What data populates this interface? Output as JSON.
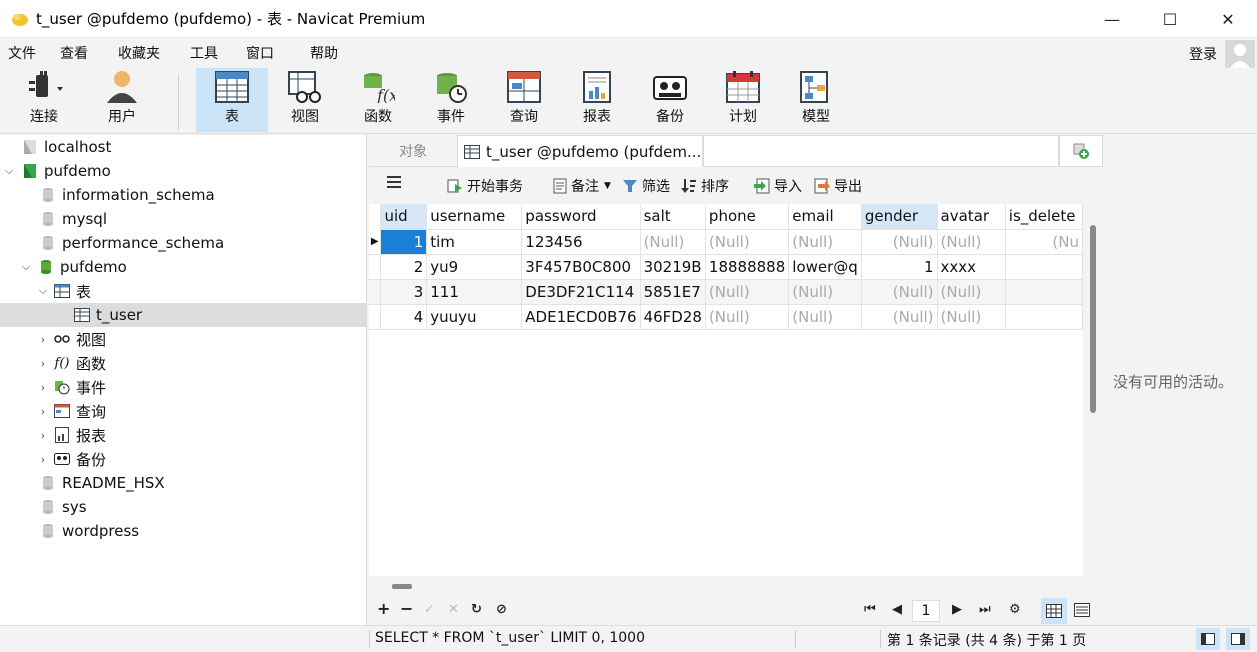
{
  "window": {
    "title": "t_user @pufdemo (pufdemo) - 表 - Navicat Premium",
    "minimize": "—",
    "maximize": "☐",
    "close": "✕"
  },
  "menu": {
    "items": [
      "文件",
      "查看",
      "收藏夹",
      "工具",
      "窗口",
      "帮助"
    ],
    "login": "登录"
  },
  "toolbar": {
    "items": [
      {
        "label": "连接",
        "icon": "connect-plug-icon"
      },
      {
        "label": "用户",
        "icon": "user-icon"
      },
      {
        "label": "表",
        "icon": "table-icon",
        "active": true
      },
      {
        "label": "视图",
        "icon": "view-glasses-icon"
      },
      {
        "label": "函数",
        "icon": "function-icon"
      },
      {
        "label": "事件",
        "icon": "event-clock-icon"
      },
      {
        "label": "查询",
        "icon": "query-icon"
      },
      {
        "label": "报表",
        "icon": "report-icon"
      },
      {
        "label": "备份",
        "icon": "backup-icon"
      },
      {
        "label": "计划",
        "icon": "calendar-icon"
      },
      {
        "label": "模型",
        "icon": "model-icon"
      }
    ]
  },
  "tree": {
    "items": [
      {
        "label": "localhost",
        "icon": "connection-icon",
        "level": 0
      },
      {
        "label": "pufdemo",
        "icon": "connection-green-icon",
        "level": 0
      },
      {
        "label": "information_schema",
        "icon": "database-icon",
        "level": 1
      },
      {
        "label": "mysql",
        "icon": "database-icon",
        "level": 1
      },
      {
        "label": "performance_schema",
        "icon": "database-icon",
        "level": 1
      },
      {
        "label": "pufdemo",
        "icon": "database-green-icon",
        "level": 1
      },
      {
        "label": "表",
        "icon": "tables-icon",
        "level": 2
      },
      {
        "label": "t_user",
        "icon": "table-icon",
        "level": 3
      },
      {
        "label": "视图",
        "icon": "view-icon",
        "level": 2
      },
      {
        "label": "函数",
        "icon": "function-icon",
        "level": 2
      },
      {
        "label": "事件",
        "icon": "event-icon",
        "level": 2
      },
      {
        "label": "查询",
        "icon": "query-icon",
        "level": 2
      },
      {
        "label": "报表",
        "icon": "report-icon",
        "level": 2
      },
      {
        "label": "备份",
        "icon": "backup-icon",
        "level": 2
      },
      {
        "label": "README_HSX",
        "icon": "database-icon",
        "level": 1
      },
      {
        "label": "sys",
        "icon": "database-icon",
        "level": 1
      },
      {
        "label": "wordpress",
        "icon": "database-icon",
        "level": 1
      }
    ]
  },
  "tabs": {
    "objects": "对象",
    "active": "t_user @pufdemo (pufdem..."
  },
  "data_toolbar": {
    "begin_transaction": "开始事务",
    "memo": "备注",
    "filter": "筛选",
    "sort": "排序",
    "import": "导入",
    "export": "导出"
  },
  "grid": {
    "columns": [
      "uid",
      "username",
      "password",
      "salt",
      "phone",
      "email",
      "gender",
      "avatar",
      "is_delete"
    ],
    "rows": [
      [
        "1",
        "tim",
        "123456",
        "(Null)",
        "(Null)",
        "(Null)",
        "(Null)",
        "(Null)",
        "(Nu"
      ],
      [
        "2",
        "yu9",
        "3F457B0C800",
        "30219B",
        "18888888",
        "lower@q",
        "1",
        "xxxx",
        ""
      ],
      [
        "3",
        "111",
        "DE3DF21C114",
        "5851E7",
        "(Null)",
        "(Null)",
        "(Null)",
        "(Null)",
        ""
      ],
      [
        "4",
        "yuuyu",
        "ADE1ECD0B76",
        "46FD28",
        "(Null)",
        "(Null)",
        "(Null)",
        "(Null)",
        ""
      ]
    ]
  },
  "bottom_nav": {
    "page": "1"
  },
  "right_panel": {
    "message": "没有可用的活动。"
  },
  "status": {
    "sql": "SELECT * FROM `t_user` LIMIT 0, 1000",
    "records": "第 1 条记录 (共 4 条) 于第 1 页"
  }
}
